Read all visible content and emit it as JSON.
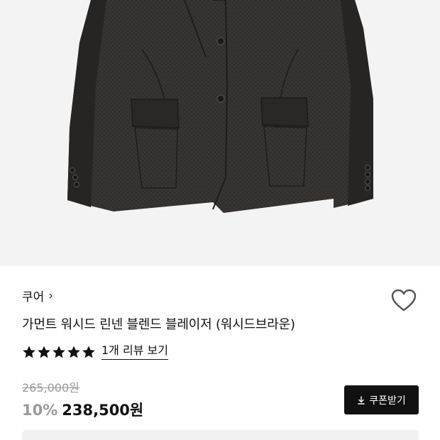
{
  "product": {
    "brand": "쿠어",
    "brand_chevron": "›",
    "title": "가먼트 워시드 린넨 블렌드 블레이저 (워시드브라운)",
    "rating": 5,
    "review_link": "1개 리뷰 보기",
    "original_price": "265,000원",
    "discount": "10%",
    "price": "238,500원"
  },
  "actions": {
    "coupon_label": "쿠폰받기"
  },
  "icons": {
    "heart": "heart-outline-icon",
    "download": "download-icon",
    "star": "star-filled-icon"
  },
  "colors": {
    "accent": "#111111",
    "muted": "#9a9a9a",
    "image_bg": "#f3f3f3",
    "jacket": "#2f2d2c"
  }
}
